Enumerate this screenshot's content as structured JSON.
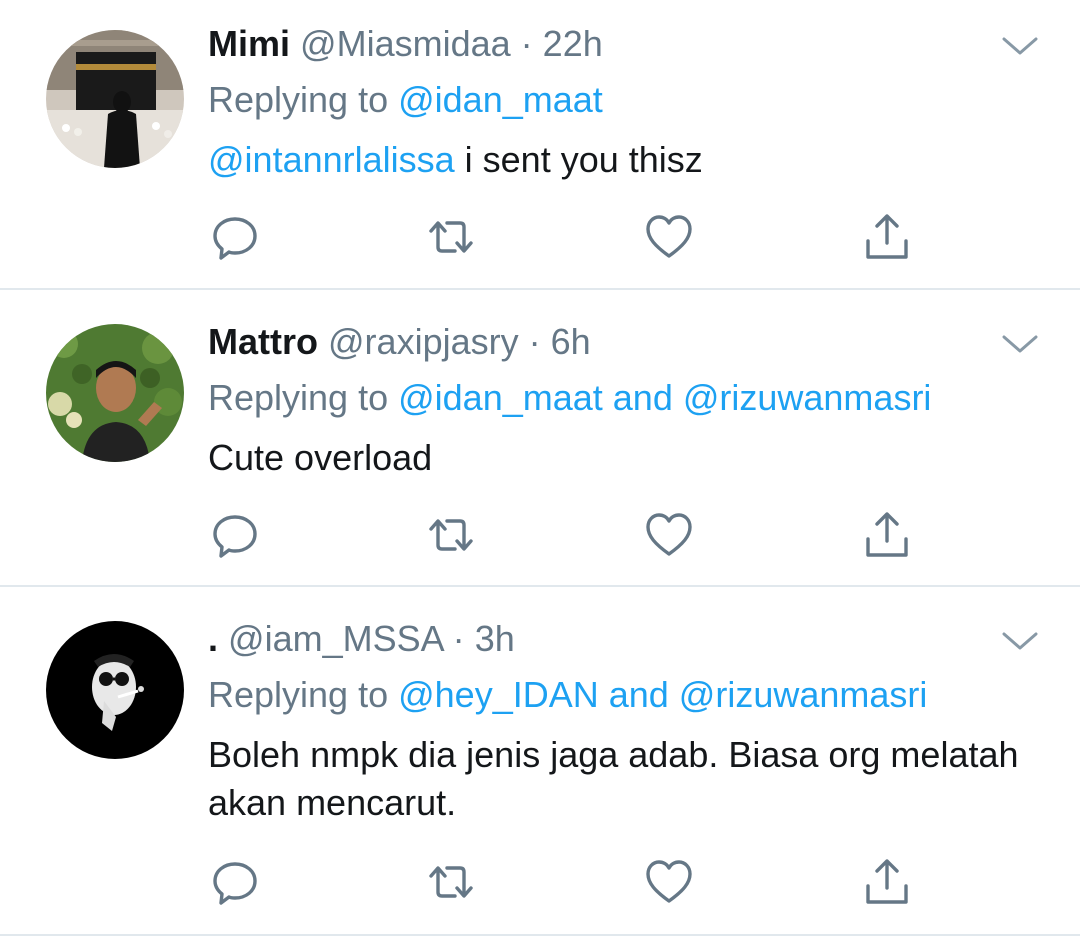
{
  "colors": {
    "link": "#1da1f2",
    "muted": "#657786",
    "text": "#14171a",
    "divider": "#e1e8ed"
  },
  "tweets": [
    {
      "name": "Mimi",
      "handle": "@Miasmidaa",
      "separator": "·",
      "time": "22h",
      "replying_prefix": "Replying to ",
      "replying_to": "@idan_maat",
      "body_mention": "@intannrlalissa",
      "body_text": " i sent you thisz",
      "avatar_icon": "avatar-kaaba-photo"
    },
    {
      "name": "Mattro",
      "handle": "@raxipjasry",
      "separator": "·",
      "time": "6h",
      "replying_prefix": "Replying to ",
      "replying_to": "@idan_maat and @rizuwanmasri",
      "body_mention": "",
      "body_text": "Cute overload",
      "avatar_icon": "avatar-man-greenery-photo"
    },
    {
      "name": ".",
      "handle": "@iam_MSSA",
      "separator": "·",
      "time": "3h",
      "replying_prefix": "Replying to ",
      "replying_to": "@hey_IDAN and @rizuwanmasri",
      "body_mention": "",
      "body_text": "Boleh nmpk dia jenis jaga adab. Biasa org melatah akan mencarut.",
      "avatar_icon": "avatar-smoking-figure-drawing"
    }
  ],
  "action_icons": [
    "reply-icon",
    "retweet-icon",
    "like-icon",
    "share-icon"
  ]
}
